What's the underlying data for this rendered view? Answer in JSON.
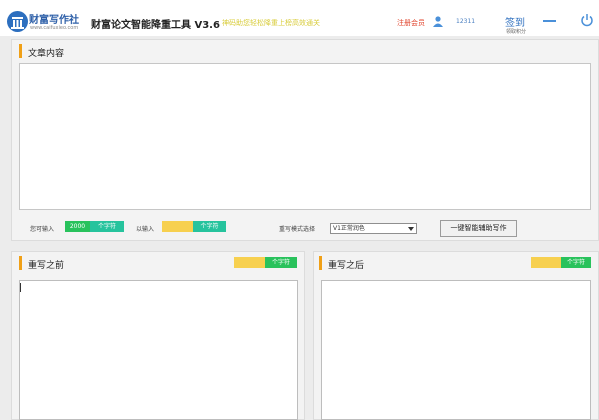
{
  "header": {
    "logo_text": "财富写作社",
    "logo_url": "www.caifuxieo.com",
    "app_title": "财富论文智能降重工具 V3.6",
    "slogan": "神码助您轻松降重上榜高效通关",
    "register_label": "注册会员",
    "user_id": "12311",
    "signin_label": "签到",
    "signin_sub": "领取积分"
  },
  "article": {
    "title": "文章内容",
    "can_input_label": "您可输入",
    "can_input_value": "2000",
    "chars_unit": "个字符",
    "entered_label": "以输入",
    "entered_value": "",
    "mode_label": "重写模式选择",
    "mode_selected": "V1正常润色",
    "rewrite_button": "一键智能辅助写作"
  },
  "before": {
    "title": "重写之前",
    "count": "",
    "chars_unit": "个字符"
  },
  "after": {
    "title": "重写之后",
    "count": "",
    "chars_unit": "个字符"
  },
  "colors": {
    "accent": "#f0a017",
    "brand_blue": "#2d6fbf",
    "green": "#29c25c",
    "teal": "#26c39d",
    "yellow": "#f7d04f"
  },
  "icons": [
    "logo-icon",
    "user-icon",
    "minimize-icon",
    "power-icon"
  ]
}
